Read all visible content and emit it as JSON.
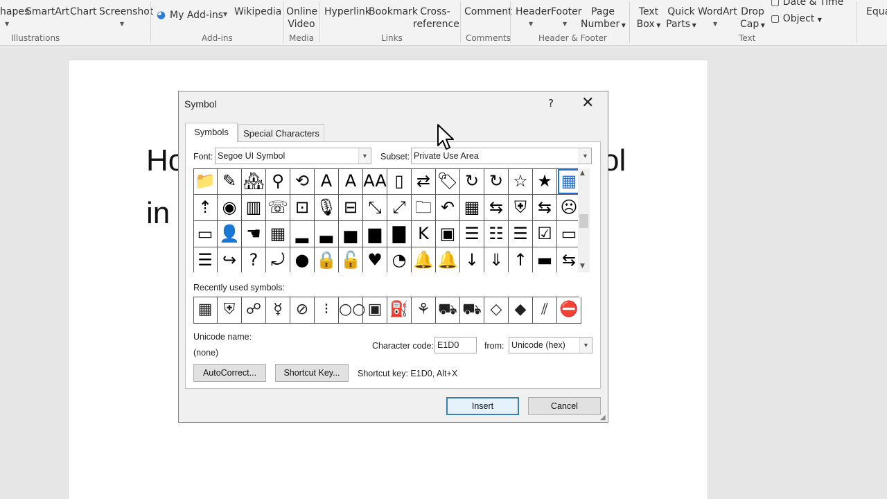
{
  "ribbon": {
    "items": {
      "shapes": "hapes",
      "smartart": "SmartArt",
      "chart": "Chart",
      "screenshot": "Screenshot",
      "my_addins": "My Add-ins",
      "wikipedia": "Wikipedia",
      "online_video_1": "Online",
      "online_video_2": "Video",
      "hyperlink": "Hyperlink",
      "bookmark": "Bookmark",
      "cross_ref_1": "Cross-",
      "cross_ref_2": "reference",
      "comment": "Comment",
      "header": "Header",
      "footer": "Footer",
      "page_number_1": "Page",
      "page_number_2": "Number",
      "text_box_1": "Text",
      "text_box_2": "Box",
      "quick_parts_1": "Quick",
      "quick_parts_2": "Parts",
      "wordart": "WordArt",
      "drop_cap_1": "Drop",
      "drop_cap_2": "Cap",
      "date_time": "Date & Time",
      "object": "Object",
      "equation": "Equa"
    },
    "groups": {
      "illustrations": "Illustrations",
      "addins": "Add-ins",
      "media": "Media",
      "links": "Links",
      "comments": "Comments",
      "header_footer": "Header & Footer",
      "text": "Text"
    }
  },
  "document": {
    "line1_left": "Ho",
    "line1_right": "ol",
    "line2_left": "in"
  },
  "dialog": {
    "title": "Symbol",
    "help": "?",
    "close": "✕",
    "tabs": [
      "Symbols",
      "Special Characters"
    ],
    "font_label": "Font:",
    "font_value": "Segoe UI Symbol",
    "subset_label": "Subset:",
    "subset_value": "Private Use Area",
    "grid_symbols": [
      "📁",
      "✎",
      "🏘",
      "⚲",
      "⟲",
      "A",
      "A",
      "AA",
      "▯",
      "⇄",
      "🏷",
      "↻",
      "↻",
      "☆",
      "★",
      "▦",
      "⇡",
      "◉",
      "▥",
      "☏",
      "⊡",
      "🎙",
      "⊟",
      "⤡",
      "⤢",
      "🗀",
      "↶",
      "▦",
      "⇆",
      "⛨",
      "⇆",
      "☹",
      "▭",
      "👤",
      "☚",
      "▦",
      "▂",
      "▃",
      "▅",
      "▆",
      "▇",
      "K",
      "▣",
      "☰",
      "☷",
      "☰",
      "☑",
      "▭",
      "☰",
      "↪",
      "?",
      "⤾",
      "●",
      "🔒",
      "🔓",
      "♥",
      "◔",
      "🔔",
      "🔔",
      "↓",
      "⇓",
      "↑",
      "▬",
      "⇆"
    ],
    "selected_index": 15,
    "recently_used_label": "Recently used symbols:",
    "recent_symbols": [
      "▦",
      "⛨",
      "☍",
      "☿",
      "⊘",
      "⁝",
      "○○",
      "▣",
      "⛽",
      "⚘",
      "⛟",
      "⛟",
      "◇",
      "◆",
      "⫽",
      "⛔"
    ],
    "unicode_name_label": "Unicode name:",
    "unicode_name_value": "(none)",
    "char_code_label": "Character code:",
    "char_code_value": "E1D0",
    "from_label": "from:",
    "from_value": "Unicode (hex)",
    "autocorrect_label": "AutoCorrect...",
    "shortcut_key_label": "Shortcut Key...",
    "shortcut_text": "Shortcut key: E1D0, Alt+X",
    "insert_label": "Insert",
    "cancel_label": "Cancel"
  },
  "colors": {
    "selection": "#1e6fd9",
    "primary_button_border": "#3c7fb1"
  }
}
